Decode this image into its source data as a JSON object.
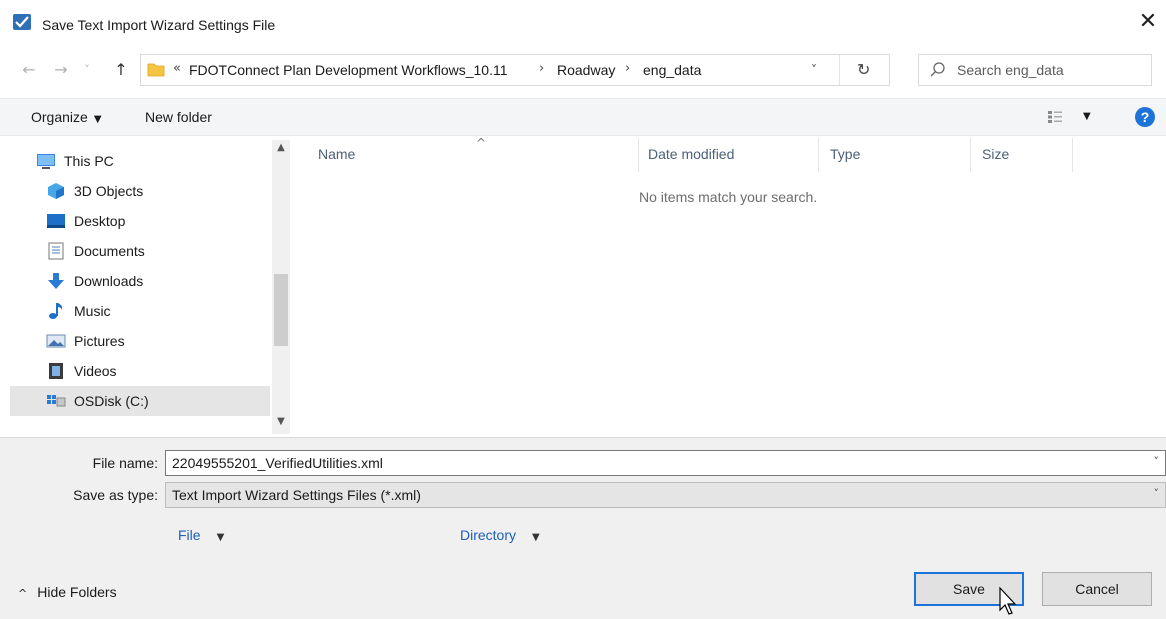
{
  "window": {
    "title": "Save Text Import Wizard Settings File",
    "close_glyph": "✕"
  },
  "nav": {
    "back_glyph": "←",
    "forward_glyph": "→",
    "recent_glyph": "˅",
    "up_glyph": "↑",
    "address": {
      "overflow": "«",
      "segments": [
        "FDOTConnect Plan Development Workflows_10.11",
        "Roadway",
        "eng_data"
      ],
      "sep1": "›",
      "sep2": "›",
      "dropdown_glyph": "˅",
      "refresh_glyph": "↻"
    },
    "search_placeholder": "Search eng_data"
  },
  "toolbar": {
    "organize_label": "Organize",
    "organize_caret": "▼",
    "new_folder_label": "New folder",
    "view_caret": "▼",
    "help_label": "?"
  },
  "sidebar": {
    "items": [
      {
        "label": "This PC",
        "icon": "monitor-icon",
        "selected": false
      },
      {
        "label": "3D Objects",
        "icon": "cube-icon",
        "selected": false
      },
      {
        "label": "Desktop",
        "icon": "desktop-icon",
        "selected": false
      },
      {
        "label": "Documents",
        "icon": "document-icon",
        "selected": false
      },
      {
        "label": "Downloads",
        "icon": "download-icon",
        "selected": false
      },
      {
        "label": "Music",
        "icon": "music-icon",
        "selected": false
      },
      {
        "label": "Pictures",
        "icon": "pictures-icon",
        "selected": false
      },
      {
        "label": "Videos",
        "icon": "video-icon",
        "selected": false
      },
      {
        "label": "OSDisk (C:)",
        "icon": "disk-icon",
        "selected": true
      }
    ],
    "scroll_up": "▲",
    "scroll_down": "▼"
  },
  "filelist": {
    "columns": [
      "Name",
      "Date modified",
      "Type",
      "Size"
    ],
    "sort_glyph": "^",
    "empty_message": "No items match your search."
  },
  "form": {
    "file_name_label": "File name:",
    "file_name_value": "22049555201_VerifiedUtilities.xml",
    "save_as_type_label": "Save as type:",
    "save_as_type_value": "Text Import Wizard Settings Files (*.xml)",
    "dropdown_glyph": "˅",
    "meta_file": "File",
    "meta_directory": "Directory",
    "meta_caret": "▼"
  },
  "footer": {
    "hide_folders_caret": "^",
    "hide_folders_label": "Hide Folders",
    "save_label": "Save",
    "cancel_label": "Cancel"
  },
  "colors": {
    "accent": "#1e73d8",
    "selected_bg": "#e5e5e5",
    "panel_bg": "#f0f0f0"
  }
}
